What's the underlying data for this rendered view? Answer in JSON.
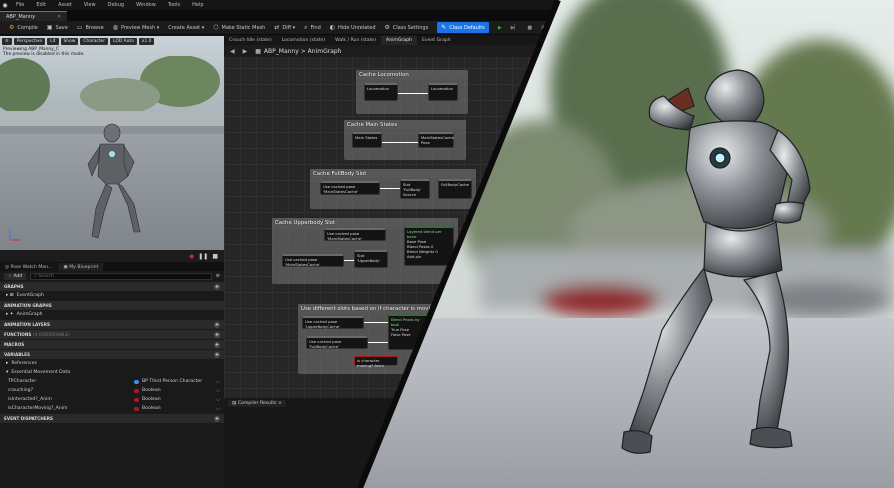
{
  "menu": {
    "items": [
      "File",
      "Edit",
      "Asset",
      "View",
      "Debug",
      "Window",
      "Tools",
      "Help"
    ]
  },
  "document_tab": {
    "title": "ABP_Manny"
  },
  "toolbar": {
    "compile": "Compile",
    "save": "Save",
    "browse": "Browse",
    "preview_mesh": "Preview Mesh",
    "create_asset": "Create Asset",
    "make_static_mesh": "Make Static Mesh",
    "diff": "Diff",
    "find": "Find",
    "hide_unrelated": "Hide Unrelated",
    "class_settings": "Class Settings",
    "class_defaults": "Class Defaults",
    "search_short": "ABP"
  },
  "viewport": {
    "buttons": [
      "Perspective",
      "Lit",
      "Show",
      "Character",
      "LOD Auto",
      "x1.0"
    ],
    "info_line1": "Previewing ABP_Manny_C",
    "info_line2": "The preview is disabled in this mode."
  },
  "my_blueprint": {
    "tabs": [
      "Pose Watch Man...",
      "My Blueprint"
    ],
    "add_label": "Add",
    "search_placeholder": "Search",
    "sections": {
      "graphs": "GRAPHS",
      "event_graph": "EventGraph",
      "animation_graphs": "ANIMATION GRAPHS",
      "anim_graph": "AnimGraph",
      "animation_layers": "ANIMATION LAYERS",
      "functions": "FUNCTIONS",
      "functions_count": "(4 OVERRIDABLE)",
      "macros": "MACROS",
      "variables": "VARIABLES",
      "references": "References",
      "essential": "Essential Movement Data",
      "event_dispatchers": "EVENT DISPATCHERS"
    },
    "variables": [
      {
        "name": "TPCharacter",
        "type": "BP Third Person Character",
        "color": "#3a8ee6"
      },
      {
        "name": "crouching?",
        "type": "Boolean",
        "color": "#a61b1b"
      },
      {
        "name": "isInteracted?_Anim",
        "type": "Boolean",
        "color": "#a61b1b"
      },
      {
        "name": "isCharacterMoving?_Anim",
        "type": "Boolean",
        "color": "#a61b1b"
      }
    ]
  },
  "graph": {
    "tabs": [
      "Crouch Idle (state)",
      "Locomotion (state)",
      "Walk / Run (state)",
      "AnimGraph",
      "Event Graph"
    ],
    "breadcrumb": {
      "root": "ABP_Manny",
      "sep": ">",
      "leaf": "AnimGraph"
    },
    "comments": [
      {
        "title": "Cache Locomotion",
        "nodes": [
          "Locomotion",
          "Locomotion"
        ]
      },
      {
        "title": "Cache Main States",
        "nodes": [
          "Main States",
          "MainStatesCache",
          "Pose"
        ]
      },
      {
        "title": "Cache FullBody Slot",
        "nodes": [
          "Use cached pose 'MainStatesCache'",
          "Slot 'FullBody'",
          "Source",
          "FullBodyCache"
        ]
      },
      {
        "title": "Cache Upperbody Slot",
        "nodes": [
          "Use cached pose 'MainStatesCache'",
          "Use cached pose 'MainStatesCache'",
          "Slot 'UpperBody'",
          "Layered blend per bone",
          "Base Pose",
          "Blend Poses 0",
          "Blend Weights 0",
          "Add pin"
        ]
      },
      {
        "title": "Use different slots based on if character is moving",
        "nodes": [
          "Use cached pose 'UpperBodyCache'",
          "Use cached pose 'FullBodyCache'",
          "Blend Poses by bool",
          "True Pose",
          "False Pose",
          "Is character moving? Anim"
        ]
      }
    ],
    "compiler_results": "Compiler Results"
  },
  "colors": {
    "accent": "#1a73e8",
    "play": "#37b24d",
    "boolean": "#a61b1b",
    "object": "#3a8ee6"
  }
}
